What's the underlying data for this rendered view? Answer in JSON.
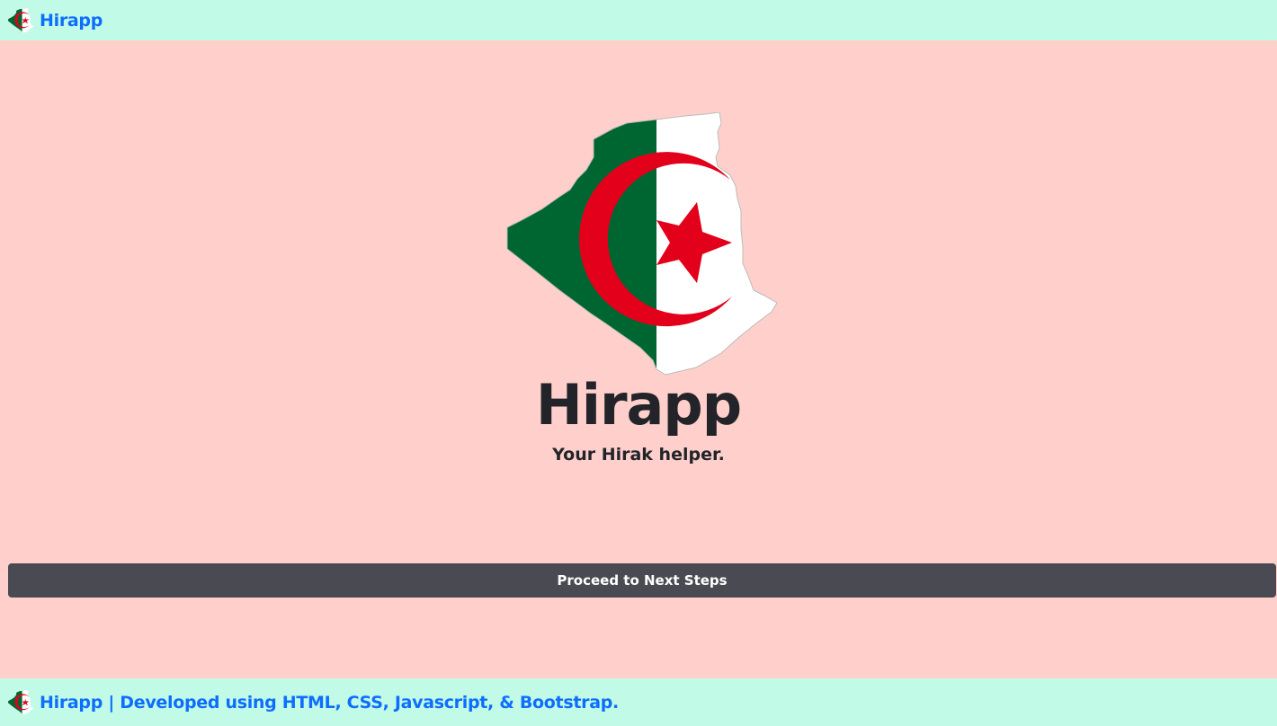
{
  "navbar": {
    "brand_label": "Hirapp",
    "brand_icon": "algeria-map-flag-icon"
  },
  "hero": {
    "image_icon": "algeria-map-flag-icon",
    "title": "Hirapp",
    "subtitle": "Your Hirak helper."
  },
  "actions": {
    "proceed_label": "Proceed to Next Steps"
  },
  "footer": {
    "icon": "algeria-map-flag-icon",
    "text": "Hirapp | Developed using HTML, CSS, Javascript, & Bootstrap."
  },
  "colors": {
    "background": "#ffd0cb",
    "bar_background": "#c1fae6",
    "link": "#0d6efd",
    "button": "#4a4a52",
    "flag_green": "#006631",
    "flag_red": "#e2001a"
  }
}
